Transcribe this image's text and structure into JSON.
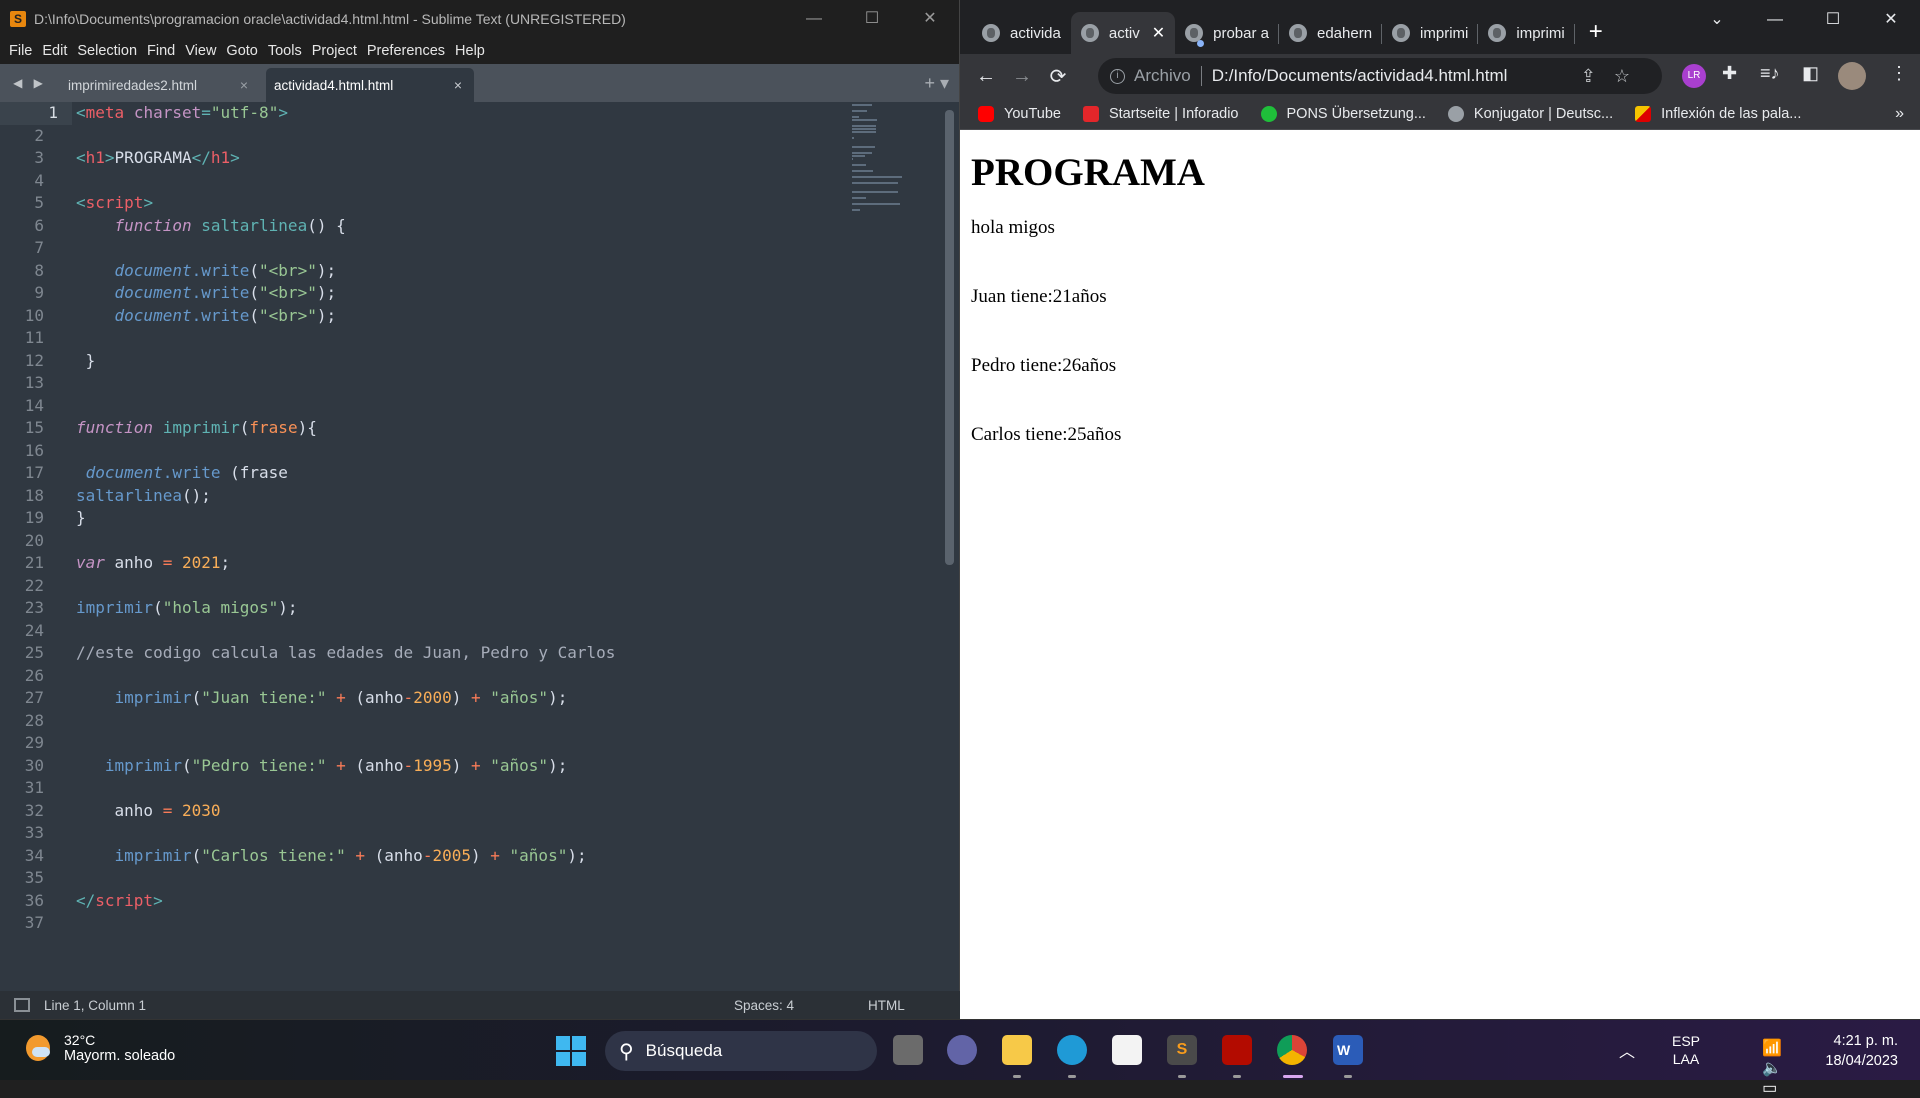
{
  "sublime": {
    "title": "D:\\Info\\Documents\\programacion oracle\\actividad4.html.html - Sublime Text (UNREGISTERED)",
    "window_controls": [
      "—",
      "☐",
      "✕"
    ],
    "menu": [
      "File",
      "Edit",
      "Selection",
      "Find",
      "View",
      "Goto",
      "Tools",
      "Project",
      "Preferences",
      "Help"
    ],
    "tabs": [
      {
        "label": "imprimiredades2.html",
        "active": false
      },
      {
        "label": "actividad4.html.html",
        "active": true
      }
    ],
    "tab_close": "×",
    "tab_nav": "◀ ▶",
    "tab_actions": "+ ▾",
    "current_line": 1,
    "code_lines": [
      [
        [
          "t-punc",
          "<"
        ],
        [
          "t-tag",
          "meta"
        ],
        [
          "t-plain",
          " "
        ],
        [
          "t-attr",
          "charset"
        ],
        [
          "t-punc",
          "="
        ],
        [
          "t-str",
          "\"utf-8\""
        ],
        [
          "t-punc",
          ">"
        ]
      ],
      [],
      [
        [
          "t-punc",
          "<"
        ],
        [
          "t-tag",
          "h1"
        ],
        [
          "t-punc",
          ">"
        ],
        [
          "t-plain",
          "PROGRAMA"
        ],
        [
          "t-punc",
          "</"
        ],
        [
          "t-tag",
          "h1"
        ],
        [
          "t-punc",
          ">"
        ]
      ],
      [],
      [
        [
          "t-punc",
          "<"
        ],
        [
          "t-tag",
          "script"
        ],
        [
          "t-punc",
          ">"
        ]
      ],
      [
        [
          "t-plain",
          "    "
        ],
        [
          "t-kw",
          "function"
        ],
        [
          "t-plain",
          " "
        ],
        [
          "t-fn",
          "saltarlinea"
        ],
        [
          "t-plain",
          "() {"
        ]
      ],
      [],
      [
        [
          "t-plain",
          "    "
        ],
        [
          "t-obj",
          "document"
        ],
        [
          "t-meth",
          ".write"
        ],
        [
          "t-plain",
          "("
        ],
        [
          "t-str",
          "\"<br>\""
        ],
        [
          "t-plain",
          ");"
        ]
      ],
      [
        [
          "t-plain",
          "    "
        ],
        [
          "t-obj",
          "document"
        ],
        [
          "t-meth",
          ".write"
        ],
        [
          "t-plain",
          "("
        ],
        [
          "t-str",
          "\"<br>\""
        ],
        [
          "t-plain",
          ");"
        ]
      ],
      [
        [
          "t-plain",
          "    "
        ],
        [
          "t-obj",
          "document"
        ],
        [
          "t-meth",
          ".write"
        ],
        [
          "t-plain",
          "("
        ],
        [
          "t-str",
          "\"<br>\""
        ],
        [
          "t-plain",
          ");"
        ]
      ],
      [],
      [
        [
          "t-plain",
          " }"
        ]
      ],
      [],
      [],
      [
        [
          "t-kw",
          "function"
        ],
        [
          "t-plain",
          " "
        ],
        [
          "t-fn",
          "imprimir"
        ],
        [
          "t-plain",
          "("
        ],
        [
          "t-param",
          "frase"
        ],
        [
          "t-plain",
          "){"
        ]
      ],
      [],
      [
        [
          "t-plain",
          " "
        ],
        [
          "t-obj",
          "document"
        ],
        [
          "t-meth",
          ".write"
        ],
        [
          "t-plain",
          " (frase"
        ]
      ],
      [
        [
          "t-call",
          "saltarlinea"
        ],
        [
          "t-plain",
          "();"
        ]
      ],
      [
        [
          "t-plain",
          "}"
        ]
      ],
      [],
      [
        [
          "t-kw",
          "var"
        ],
        [
          "t-plain",
          " anho "
        ],
        [
          "t-op",
          "="
        ],
        [
          "t-plain",
          " "
        ],
        [
          "t-num",
          "2021"
        ],
        [
          "t-plain",
          ";"
        ]
      ],
      [],
      [
        [
          "t-call",
          "imprimir"
        ],
        [
          "t-plain",
          "("
        ],
        [
          "t-str",
          "\"hola migos\""
        ],
        [
          "t-plain",
          ");"
        ]
      ],
      [],
      [
        [
          "t-cmt",
          "//este codigo calcula las edades de Juan, Pedro y Carlos"
        ]
      ],
      [],
      [
        [
          "t-plain",
          "    "
        ],
        [
          "t-call",
          "imprimir"
        ],
        [
          "t-plain",
          "("
        ],
        [
          "t-str",
          "\"Juan tiene:\""
        ],
        [
          "t-plain",
          " "
        ],
        [
          "t-op",
          "+"
        ],
        [
          "t-plain",
          " (anho"
        ],
        [
          "t-op",
          "-"
        ],
        [
          "t-num",
          "2000"
        ],
        [
          "t-plain",
          ") "
        ],
        [
          "t-op",
          "+"
        ],
        [
          "t-plain",
          " "
        ],
        [
          "t-str",
          "\"años\""
        ],
        [
          "t-plain",
          ");"
        ]
      ],
      [],
      [],
      [
        [
          "t-plain",
          "   "
        ],
        [
          "t-call",
          "imprimir"
        ],
        [
          "t-plain",
          "("
        ],
        [
          "t-str",
          "\"Pedro tiene:\""
        ],
        [
          "t-plain",
          " "
        ],
        [
          "t-op",
          "+"
        ],
        [
          "t-plain",
          " (anho"
        ],
        [
          "t-op",
          "-"
        ],
        [
          "t-num",
          "1995"
        ],
        [
          "t-plain",
          ") "
        ],
        [
          "t-op",
          "+"
        ],
        [
          "t-plain",
          " "
        ],
        [
          "t-str",
          "\"años\""
        ],
        [
          "t-plain",
          ");"
        ]
      ],
      [],
      [
        [
          "t-plain",
          "    anho "
        ],
        [
          "t-op",
          "="
        ],
        [
          "t-plain",
          " "
        ],
        [
          "t-num",
          "2030"
        ]
      ],
      [],
      [
        [
          "t-plain",
          "    "
        ],
        [
          "t-call",
          "imprimir"
        ],
        [
          "t-plain",
          "("
        ],
        [
          "t-str",
          "\"Carlos tiene:\""
        ],
        [
          "t-plain",
          " "
        ],
        [
          "t-op",
          "+"
        ],
        [
          "t-plain",
          " (anho"
        ],
        [
          "t-op",
          "-"
        ],
        [
          "t-num",
          "2005"
        ],
        [
          "t-plain",
          ") "
        ],
        [
          "t-op",
          "+"
        ],
        [
          "t-plain",
          " "
        ],
        [
          "t-str",
          "\"años\""
        ],
        [
          "t-plain",
          ");"
        ]
      ],
      [],
      [
        [
          "t-punc",
          "</"
        ],
        [
          "t-tag",
          "script"
        ],
        [
          "t-punc",
          ">"
        ]
      ],
      []
    ],
    "status": {
      "position": "Line 1, Column 1",
      "indentation": "Spaces: 4",
      "syntax": "HTML"
    }
  },
  "chrome": {
    "tabs": [
      {
        "label": "activida",
        "active": false,
        "loading_dot": false
      },
      {
        "label": "activ",
        "active": true,
        "loading_dot": false
      },
      {
        "label": "probar a",
        "active": false,
        "loading_dot": true
      },
      {
        "label": "edahern",
        "active": false,
        "loading_dot": false
      },
      {
        "label": "imprimi",
        "active": false,
        "loading_dot": false
      },
      {
        "label": "imprimi",
        "active": false,
        "loading_dot": false
      }
    ],
    "tab_close": "✕",
    "new_tab": "+",
    "window_controls": [
      "⌄",
      "—",
      "☐",
      "✕"
    ],
    "nav": {
      "back": "←",
      "forward": "→",
      "reload": "⟳"
    },
    "address": {
      "scheme_label": "Archivo",
      "url": "D:/Info/Documents/actividad4.html.html"
    },
    "omnibox_icons": [
      "share-icon",
      "star-icon"
    ],
    "extensions": {
      "lr_label": "LR"
    },
    "bookmarks": [
      {
        "label": "YouTube",
        "icon": "youtube-icon"
      },
      {
        "label": "Startseite | Inforadio",
        "icon": "rbb-icon"
      },
      {
        "label": "PONS Übersetzung...",
        "icon": "pons-icon"
      },
      {
        "label": "Konjugator | Deutsc...",
        "icon": "globe-icon"
      },
      {
        "label": "Inflexión de las pala...",
        "icon": "inflexion-icon"
      }
    ],
    "bookmarks_more": "»",
    "page": {
      "heading": "PROGRAMA",
      "lines": [
        "hola migos",
        "Juan tiene:21años",
        "Pedro tiene:26años",
        "Carlos tiene:25años"
      ]
    }
  },
  "taskbar": {
    "weather": {
      "temp": "32°C",
      "desc": "Mayorm. soleado"
    },
    "search_label": "Búsqueda",
    "apps": [
      "task-view",
      "teams",
      "file-explorer",
      "edge",
      "store",
      "sublime-text",
      "acrobat",
      "chrome",
      "word"
    ],
    "active_app": "chrome",
    "tray": {
      "lang1": "ESP",
      "lang2": "LAA",
      "time": "4:21 p. m.",
      "date": "18/04/2023"
    }
  }
}
